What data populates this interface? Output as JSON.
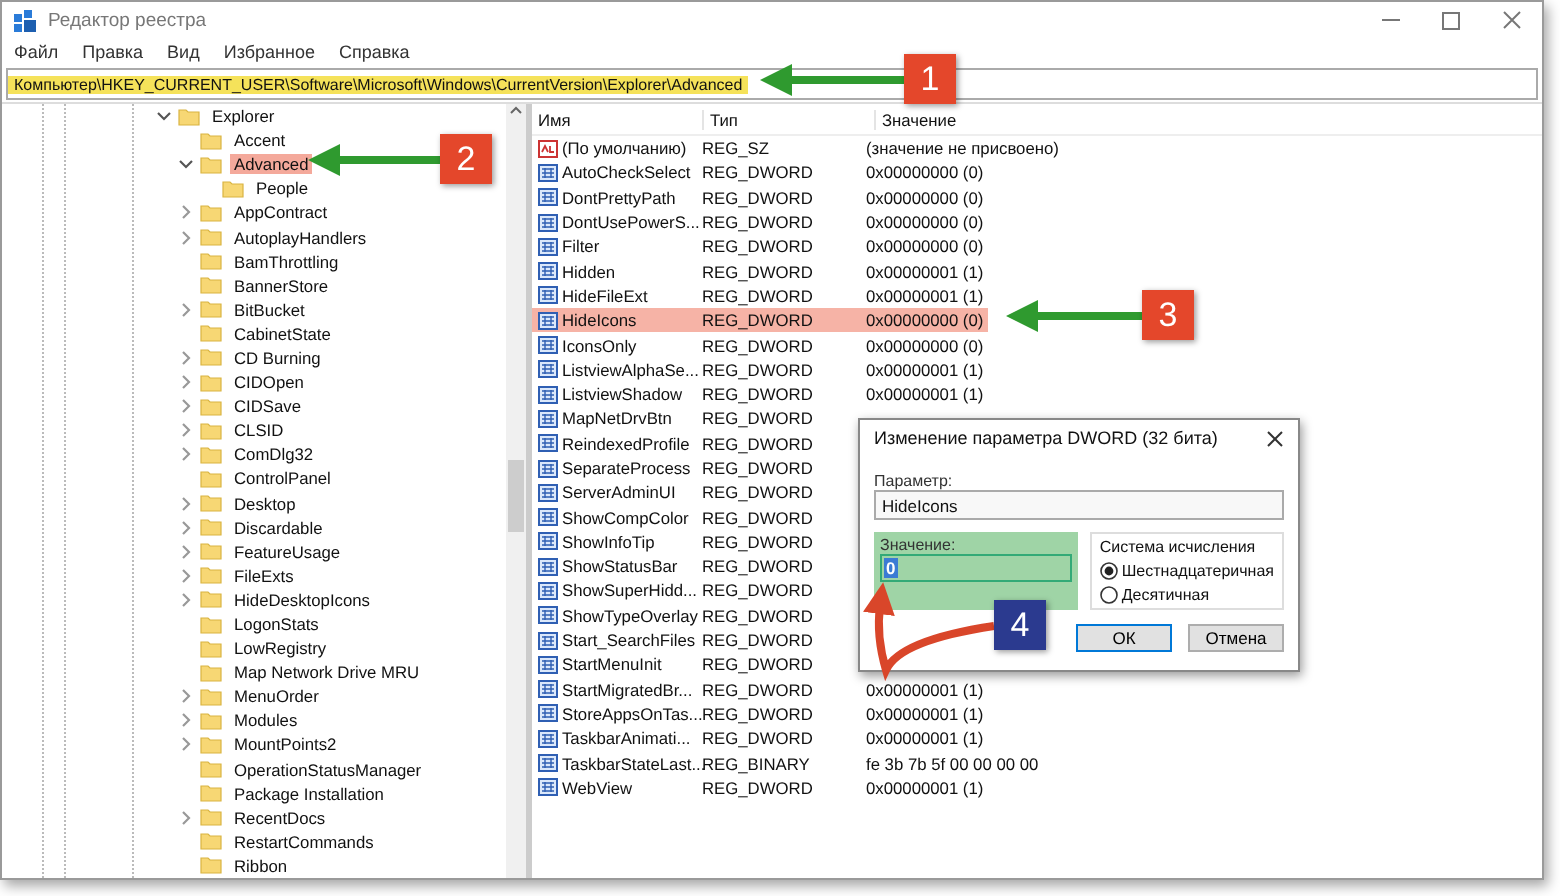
{
  "window": {
    "title": "Редактор реестра"
  },
  "menu": [
    "Файл",
    "Правка",
    "Вид",
    "Избранное",
    "Справка"
  ],
  "address": "Компьютер\\HKEY_CURRENT_USER\\Software\\Microsoft\\Windows\\CurrentVersion\\Explorer\\Advanced",
  "tree": [
    {
      "label": "Explorer",
      "expandable": true,
      "expanded": true,
      "selected": false,
      "children": [
        {
          "label": "Accent",
          "expandable": false,
          "expanded": false,
          "selected": false
        },
        {
          "label": "Advanced",
          "expandable": true,
          "expanded": true,
          "selected": true,
          "children": [
            {
              "label": "People",
              "expandable": false,
              "expanded": false,
              "selected": false
            }
          ]
        },
        {
          "label": "AppContract",
          "expandable": true,
          "expanded": false,
          "selected": false
        },
        {
          "label": "AutoplayHandlers",
          "expandable": true,
          "expanded": false,
          "selected": false
        },
        {
          "label": "BamThrottling",
          "expandable": false,
          "expanded": false,
          "selected": false
        },
        {
          "label": "BannerStore",
          "expandable": false,
          "expanded": false,
          "selected": false
        },
        {
          "label": "BitBucket",
          "expandable": true,
          "expanded": false,
          "selected": false
        },
        {
          "label": "CabinetState",
          "expandable": false,
          "expanded": false,
          "selected": false
        },
        {
          "label": "CD Burning",
          "expandable": true,
          "expanded": false,
          "selected": false
        },
        {
          "label": "CIDOpen",
          "expandable": true,
          "expanded": false,
          "selected": false
        },
        {
          "label": "CIDSave",
          "expandable": true,
          "expanded": false,
          "selected": false
        },
        {
          "label": "CLSID",
          "expandable": true,
          "expanded": false,
          "selected": false
        },
        {
          "label": "ComDlg32",
          "expandable": true,
          "expanded": false,
          "selected": false
        },
        {
          "label": "ControlPanel",
          "expandable": false,
          "expanded": false,
          "selected": false
        },
        {
          "label": "Desktop",
          "expandable": true,
          "expanded": false,
          "selected": false
        },
        {
          "label": "Discardable",
          "expandable": true,
          "expanded": false,
          "selected": false
        },
        {
          "label": "FeatureUsage",
          "expandable": true,
          "expanded": false,
          "selected": false
        },
        {
          "label": "FileExts",
          "expandable": true,
          "expanded": false,
          "selected": false
        },
        {
          "label": "HideDesktopIcons",
          "expandable": true,
          "expanded": false,
          "selected": false
        },
        {
          "label": "LogonStats",
          "expandable": false,
          "expanded": false,
          "selected": false
        },
        {
          "label": "LowRegistry",
          "expandable": false,
          "expanded": false,
          "selected": false
        },
        {
          "label": "Map Network Drive MRU",
          "expandable": false,
          "expanded": false,
          "selected": false
        },
        {
          "label": "MenuOrder",
          "expandable": true,
          "expanded": false,
          "selected": false
        },
        {
          "label": "Modules",
          "expandable": true,
          "expanded": false,
          "selected": false
        },
        {
          "label": "MountPoints2",
          "expandable": true,
          "expanded": false,
          "selected": false
        },
        {
          "label": "OperationStatusManager",
          "expandable": false,
          "expanded": false,
          "selected": false
        },
        {
          "label": "Package Installation",
          "expandable": false,
          "expanded": false,
          "selected": false
        },
        {
          "label": "RecentDocs",
          "expandable": true,
          "expanded": false,
          "selected": false
        },
        {
          "label": "RestartCommands",
          "expandable": false,
          "expanded": false,
          "selected": false
        },
        {
          "label": "Ribbon",
          "expandable": false,
          "expanded": false,
          "selected": false
        }
      ]
    }
  ],
  "table": {
    "columns": [
      "Имя",
      "Тип",
      "Значение"
    ],
    "rows": [
      {
        "kind": "string",
        "name": "(По умолчанию)",
        "type": "REG_SZ",
        "value": "(значение не присвоено)",
        "selected": false
      },
      {
        "kind": "dword",
        "name": "AutoCheckSelect",
        "type": "REG_DWORD",
        "value": "0x00000000 (0)",
        "selected": false
      },
      {
        "kind": "dword",
        "name": "DontPrettyPath",
        "type": "REG_DWORD",
        "value": "0x00000000 (0)",
        "selected": false
      },
      {
        "kind": "dword",
        "name": "DontUsePowerS...",
        "type": "REG_DWORD",
        "value": "0x00000000 (0)",
        "selected": false
      },
      {
        "kind": "dword",
        "name": "Filter",
        "type": "REG_DWORD",
        "value": "0x00000000 (0)",
        "selected": false
      },
      {
        "kind": "dword",
        "name": "Hidden",
        "type": "REG_DWORD",
        "value": "0x00000001 (1)",
        "selected": false
      },
      {
        "kind": "dword",
        "name": "HideFileExt",
        "type": "REG_DWORD",
        "value": "0x00000001 (1)",
        "selected": false
      },
      {
        "kind": "dword",
        "name": "HideIcons",
        "type": "REG_DWORD",
        "value": "0x00000000 (0)",
        "selected": true
      },
      {
        "kind": "dword",
        "name": "IconsOnly",
        "type": "REG_DWORD",
        "value": "0x00000000 (0)",
        "selected": false
      },
      {
        "kind": "dword",
        "name": "ListviewAlphaSe...",
        "type": "REG_DWORD",
        "value": "0x00000001 (1)",
        "selected": false
      },
      {
        "kind": "dword",
        "name": "ListviewShadow",
        "type": "REG_DWORD",
        "value": "0x00000001 (1)",
        "selected": false
      },
      {
        "kind": "dword",
        "name": "MapNetDrvBtn",
        "type": "REG_DWORD",
        "selected": false
      },
      {
        "kind": "dword",
        "name": "ReindexedProfile",
        "type": "REG_DWORD",
        "selected": false
      },
      {
        "kind": "dword",
        "name": "SeparateProcess",
        "type": "REG_DWORD",
        "selected": false
      },
      {
        "kind": "dword",
        "name": "ServerAdminUI",
        "type": "REG_DWORD",
        "selected": false
      },
      {
        "kind": "dword",
        "name": "ShowCompColor",
        "type": "REG_DWORD",
        "selected": false
      },
      {
        "kind": "dword",
        "name": "ShowInfoTip",
        "type": "REG_DWORD",
        "selected": false
      },
      {
        "kind": "dword",
        "name": "ShowStatusBar",
        "type": "REG_DWORD",
        "selected": false
      },
      {
        "kind": "dword",
        "name": "ShowSuperHidd...",
        "type": "REG_DWORD",
        "selected": false
      },
      {
        "kind": "dword",
        "name": "ShowTypeOverlay",
        "type": "REG_DWORD",
        "selected": false
      },
      {
        "kind": "dword",
        "name": "Start_SearchFiles",
        "type": "REG_DWORD",
        "selected": false
      },
      {
        "kind": "dword",
        "name": "StartMenuInit",
        "type": "REG_DWORD",
        "selected": false
      },
      {
        "kind": "dword",
        "name": "StartMigratedBr...",
        "type": "REG_DWORD",
        "value": "0x00000001 (1)",
        "selected": false
      },
      {
        "kind": "dword",
        "name": "StoreAppsOnTas...",
        "type": "REG_DWORD",
        "value": "0x00000001 (1)",
        "selected": false
      },
      {
        "kind": "dword",
        "name": "TaskbarAnimati...",
        "type": "REG_DWORD",
        "value": "0x00000001 (1)",
        "selected": false
      },
      {
        "kind": "binary",
        "name": "TaskbarStateLast...",
        "type": "REG_BINARY",
        "value": "fe 3b 7b 5f 00 00 00 00",
        "selected": false
      },
      {
        "kind": "dword",
        "name": "WebView",
        "type": "REG_DWORD",
        "value": "0x00000001 (1)",
        "selected": false
      }
    ]
  },
  "dialog": {
    "title": "Изменение параметра DWORD (32 бита)",
    "name_label": "Параметр:",
    "name_value": "HideIcons",
    "value_label": "Значение:",
    "value": "0",
    "base_label": "Система исчисления",
    "bases": [
      {
        "label": "Шестнадцатеричная",
        "selected": true
      },
      {
        "label": "Десятичная",
        "selected": false
      }
    ],
    "buttons": [
      "ОК",
      "Отмена"
    ]
  },
  "annotations": [
    {
      "number": "1",
      "color": "#e4472b"
    },
    {
      "number": "2",
      "color": "#e4472b"
    },
    {
      "number": "3",
      "color": "#e4472b"
    },
    {
      "number": "4",
      "color": "#2b3a8f"
    }
  ]
}
